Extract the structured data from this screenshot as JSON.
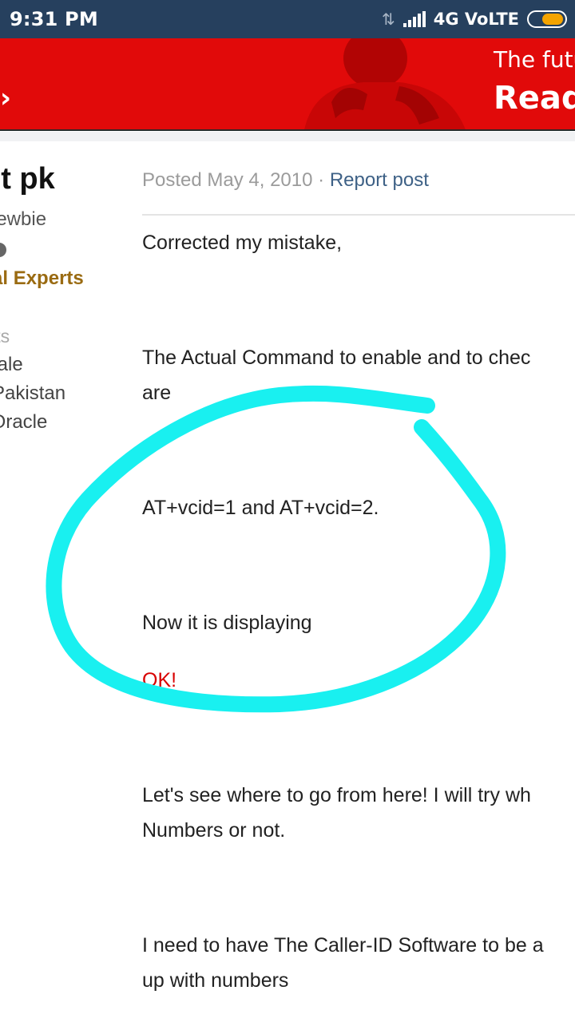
{
  "status_bar": {
    "time": "9:31 PM",
    "network": "4G VoLTE",
    "icons": [
      "data-transfer-icon",
      "signal-strength-icon",
      "battery-icon"
    ],
    "battery_color": "#f5a400"
  },
  "ad": {
    "line1": "The futu",
    "line2": "Read",
    "chevron": "›",
    "background": "#e10a0a"
  },
  "author": {
    "name": "nt pk",
    "rank": "Newbie",
    "group": "ical Experts",
    "posts_label": "osts",
    "gender": ":Male",
    "location": "n:Pakistan",
    "interests": "s:Oracle"
  },
  "post": {
    "posted": "Posted May 4, 2010",
    "separator": "·",
    "report": "Report post",
    "lines": [
      "Corrected my mistake,",
      "The Actual Command to enable and to chec",
      "are",
      "AT+vcid=1 and AT+vcid=2.",
      "Now it is displaying",
      "OK!",
      "Let's see where to go from here! I will try wh",
      "Numbers or not.",
      "I need to have The Caller-ID Software to be a",
      "up with numbers"
    ]
  },
  "annotation": {
    "shape": "hand-drawn circle",
    "color": "#19f0f0"
  }
}
